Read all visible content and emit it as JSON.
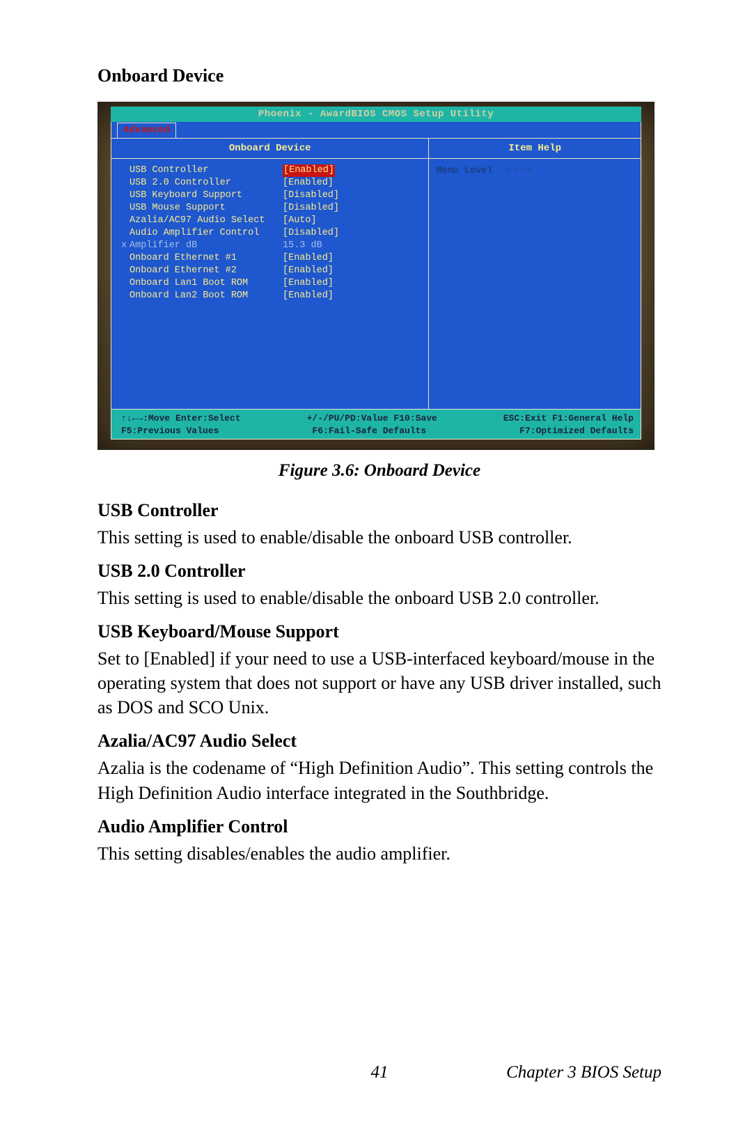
{
  "section_heading": "Onboard Device",
  "figure_caption": "Figure 3.6: Onboard Device",
  "bios": {
    "title": "Phoenix - AwardBIOS CMOS Setup Utility",
    "tab": "Advanced",
    "left_header": "Onboard Device",
    "right_header": "Item Help",
    "menu_level_label": "Menu Level",
    "menu_level_arrows": "▸▸▸▸",
    "settings": [
      {
        "label": "USB Controller",
        "value": "[Enabled]",
        "selected": true,
        "muted": false
      },
      {
        "label": "USB 2.0 Controller",
        "value": "[Enabled]",
        "selected": false,
        "muted": false
      },
      {
        "label": "USB Keyboard Support",
        "value": "[Disabled]",
        "selected": false,
        "muted": false
      },
      {
        "label": "USB Mouse Support",
        "value": "[Disabled]",
        "selected": false,
        "muted": false
      },
      {
        "label": "Azalia/AC97 Audio Select",
        "value": "[Auto]",
        "selected": false,
        "muted": false
      },
      {
        "label": "Audio Amplifier Control",
        "value": "[Disabled]",
        "selected": false,
        "muted": false
      },
      {
        "label": "Amplifier dB",
        "value": "15.3 dB",
        "selected": false,
        "muted": true,
        "prefix": "x"
      },
      {
        "label": "Onboard Ethernet #1",
        "value": "[Enabled]",
        "selected": false,
        "muted": false
      },
      {
        "label": "Onboard Ethernet #2",
        "value": "[Enabled]",
        "selected": false,
        "muted": false
      },
      {
        "label": "Onboard Lan1 Boot ROM",
        "value": "[Enabled]",
        "selected": false,
        "muted": false
      },
      {
        "label": "Onboard Lan2 Boot ROM",
        "value": "[Enabled]",
        "selected": false,
        "muted": false
      }
    ],
    "footer": {
      "l1a": "↑↓←→:Move  Enter:Select",
      "l1b": "+/-/PU/PD:Value  F10:Save",
      "l1c": "ESC:Exit  F1:General Help",
      "l2a": "F5:Previous Values",
      "l2b": "F6:Fail-Safe Defaults",
      "l2c": "F7:Optimized Defaults"
    }
  },
  "descriptions": [
    {
      "title": "USB Controller",
      "text": "This setting is used to enable/disable the onboard USB controller."
    },
    {
      "title": "USB 2.0 Controller",
      "text": "This setting is used to enable/disable the onboard USB 2.0 controller."
    },
    {
      "title": "USB Keyboard/Mouse Support",
      "text": "Set to [Enabled] if your need to use a USB-interfaced keyboard/mouse in the operating system that does not support or have any USB driver installed, such as DOS and SCO Unix."
    },
    {
      "title": "Azalia/AC97 Audio Select",
      "text": "Azalia is the codename of “High Definition Audio”. This setting controls the High Definition Audio interface integrated in the Southbridge."
    },
    {
      "title": "Audio Amplifier Control",
      "text": "This setting disables/enables the audio amplifier."
    }
  ],
  "page_number": "41",
  "chapter_label": "Chapter 3  BIOS Setup"
}
